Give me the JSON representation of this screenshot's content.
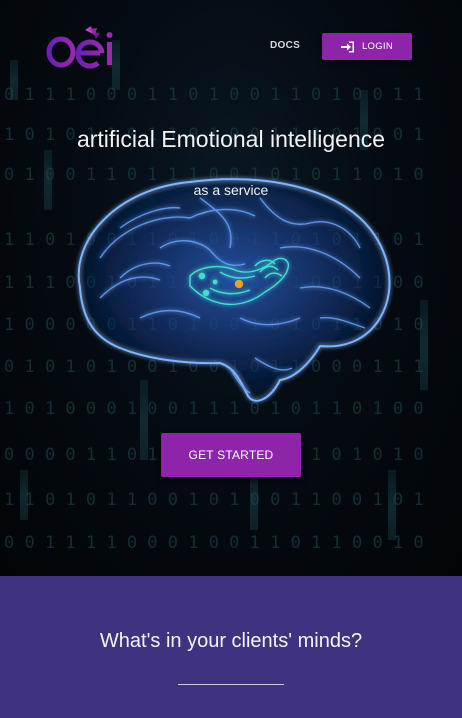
{
  "nav": {
    "logo_text": "aei",
    "docs_label": "DOCS",
    "login_label": "LOGIN",
    "login_icon": "sign-in-icon"
  },
  "hero": {
    "headline": "artificial Emotional intelligence",
    "subline": "as a service",
    "illustration": "glowing-brain-illustration",
    "cta_label": "GET STARTED"
  },
  "section": {
    "title": "What's in your clients' minds?"
  },
  "colors": {
    "accent": "#8e24aa",
    "section_bg": "#3e3281",
    "hero_bg": "#050b12",
    "brain_glow": "#4a8fff",
    "amygdala": "#2ee6d6",
    "dot": "#f0a020"
  }
}
